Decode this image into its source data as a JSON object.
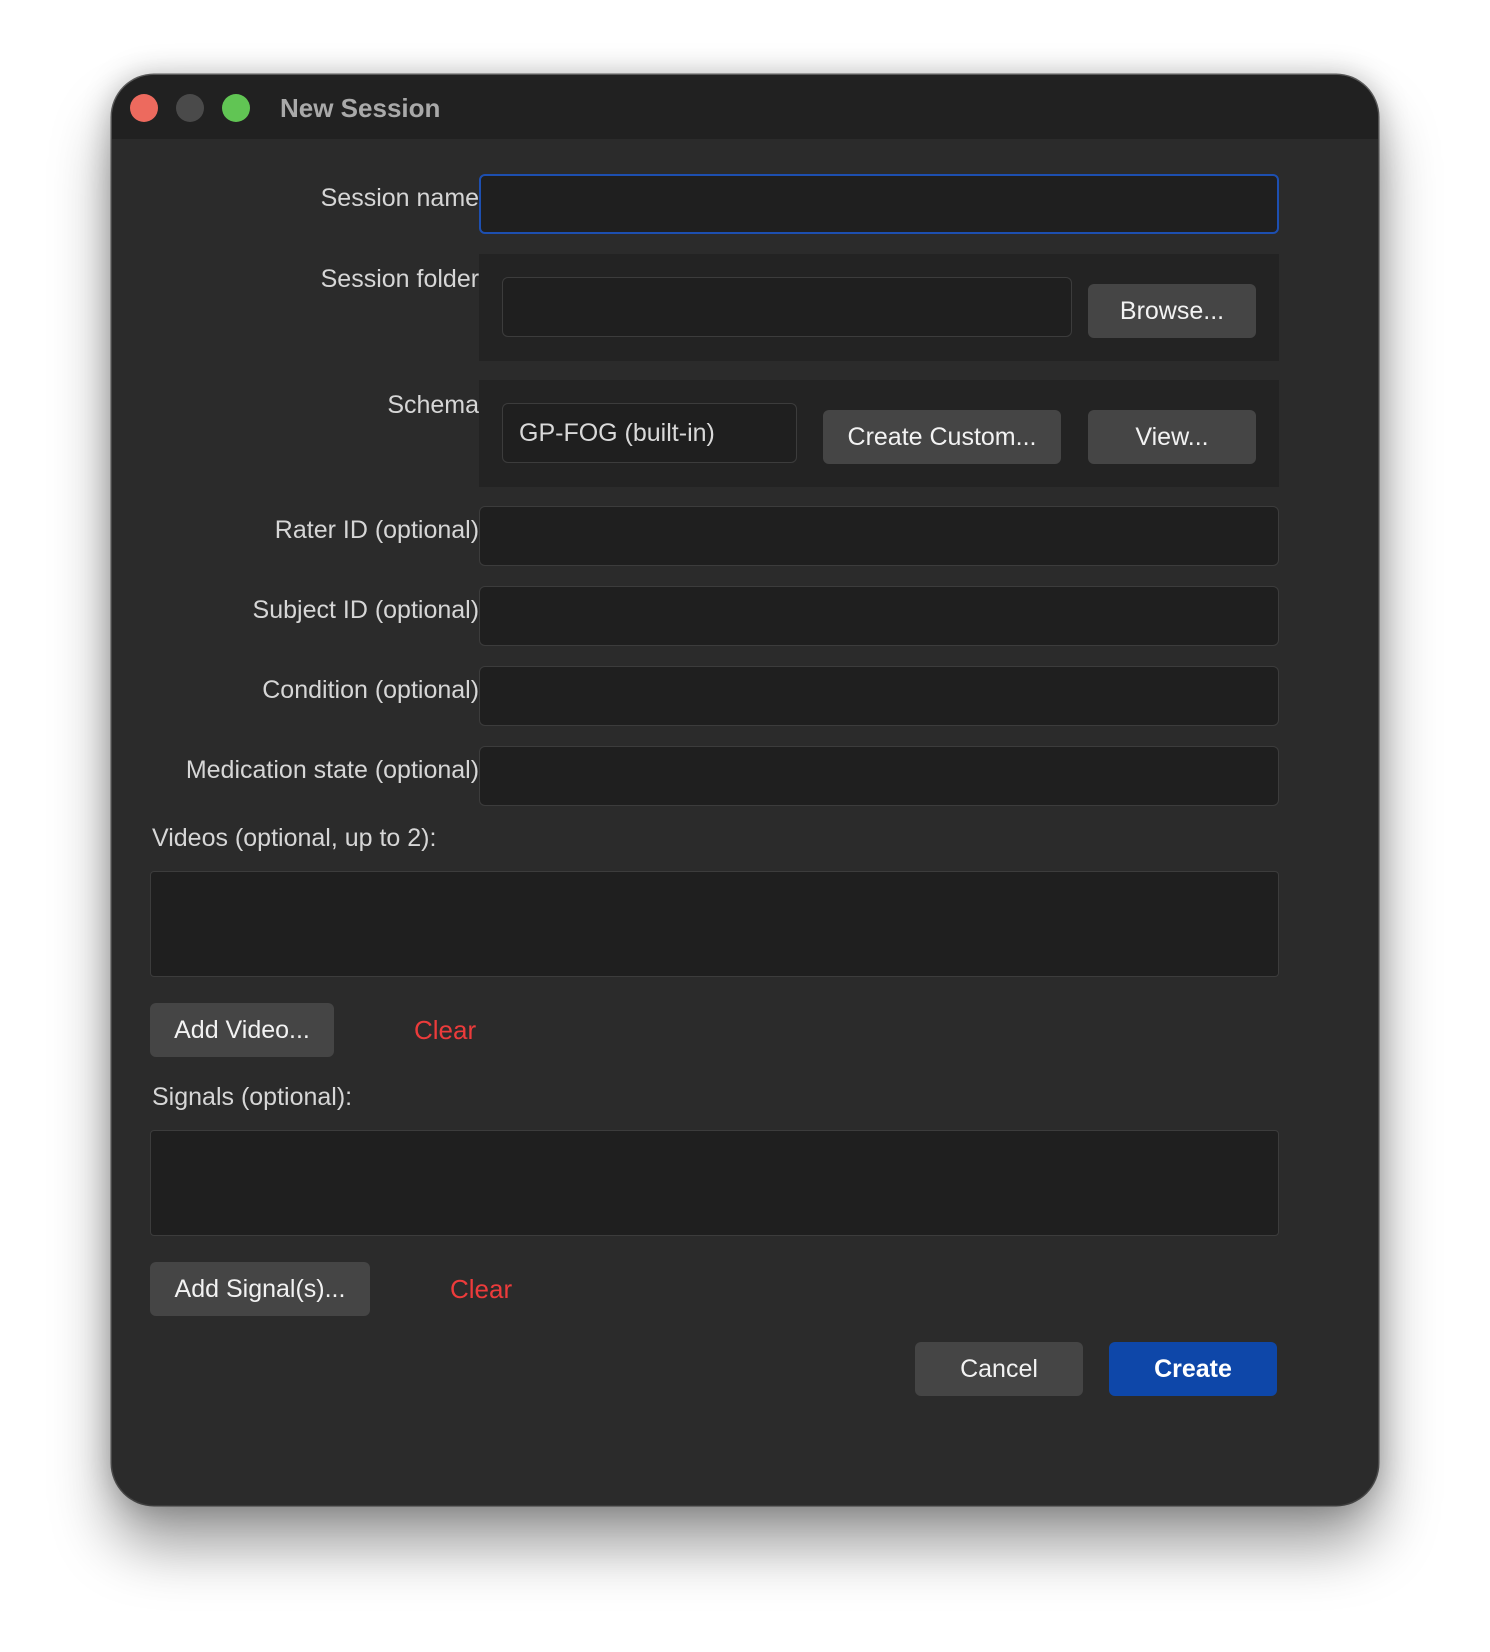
{
  "window": {
    "title": "New Session"
  },
  "form": {
    "session_name": {
      "label": "Session name:",
      "value": ""
    },
    "session_folder": {
      "label": "Session folder:",
      "value": "",
      "browse_label": "Browse..."
    },
    "schema": {
      "label": "Schema:",
      "value": "GP-FOG (built-in)",
      "create_custom_label": "Create Custom...",
      "view_label": "View..."
    },
    "rater_id": {
      "label": "Rater ID (optional):",
      "value": ""
    },
    "subject_id": {
      "label": "Subject ID (optional):",
      "value": ""
    },
    "condition": {
      "label": "Condition (optional):",
      "value": ""
    },
    "medication_state": {
      "label": "Medication state (optional):",
      "value": ""
    },
    "videos": {
      "label": "Videos (optional, up to 2):",
      "add_label": "Add Video...",
      "clear_label": "Clear",
      "items": []
    },
    "signals": {
      "label": "Signals (optional):",
      "add_label": "Add Signal(s)...",
      "clear_label": "Clear",
      "items": []
    }
  },
  "actions": {
    "cancel_label": "Cancel",
    "create_label": "Create"
  },
  "colors": {
    "accent": "#0e47a9",
    "focus_ring": "#1d4fb0",
    "clear_text": "#ec3b3b",
    "traffic_close": "#ed6a5e",
    "traffic_minimize_inactive": "#4a4a4a",
    "traffic_zoom": "#61c554"
  }
}
